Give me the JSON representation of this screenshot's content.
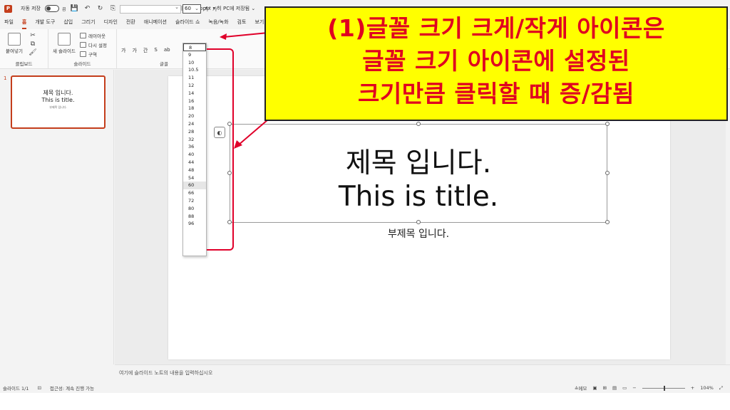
{
  "titlebar": {
    "autosave_label": "자동 저장",
    "autosave_state": "끔",
    "document_title": "New 프레젠테이션 문서.pptx • 이 PC에 저장됨 ⌄"
  },
  "tabs": [
    "파일",
    "홈",
    "개발 도구",
    "삽입",
    "그리기",
    "디자인",
    "전환",
    "애니메이션",
    "슬라이드 쇼",
    "녹음/녹화",
    "검토",
    "보기"
  ],
  "active_tab": "홈",
  "ribbon": {
    "clipboard": {
      "paste_label": "붙여넣기",
      "group_label": "클립보드"
    },
    "slides": {
      "new_slide_label": "새 슬라이드",
      "layout_label": "레이아웃",
      "reset_label": "다시 설정",
      "section_label": "구역",
      "group_label": "슬라이드"
    },
    "font": {
      "size_value": "60",
      "grow_label": "가˄",
      "shrink_label": "가˅",
      "group_label": "글꼴",
      "format_buttons": [
        "가",
        "가",
        "간",
        "S",
        "ab"
      ]
    }
  },
  "font_sizes": [
    "8",
    "9",
    "10",
    "10.5",
    "11",
    "12",
    "14",
    "16",
    "18",
    "20",
    "24",
    "28",
    "32",
    "36",
    "40",
    "44",
    "48",
    "54",
    "60",
    "66",
    "72",
    "80",
    "88",
    "96"
  ],
  "selected_size": "60",
  "slide_panel": {
    "slide_number": "1",
    "thumb_title_line1": "제목 입니다.",
    "thumb_title_line2": "This is title.",
    "thumb_subtitle": "부제목 입니다."
  },
  "slide": {
    "title_line1": "제목 입니다.",
    "title_line2": "This is title.",
    "subtitle": "부제목 입니다."
  },
  "notes_placeholder": "여기에 슬라이드 노트의 내용을 입력하십시오",
  "statusbar": {
    "slide_count": "슬라이드 1/1",
    "accessibility": "접근성: 계속 진행 가능",
    "notes_label": "≙메모",
    "zoom": "104%"
  },
  "callout": {
    "line1": "(1)글꼴 크기 크게/작게 아이콘은",
    "line2": "글꼴 크기 아이콘에 설정된",
    "line3": "크기만큼 클릭할 때 증/감됨"
  },
  "colors": {
    "accent": "#c43e1c",
    "callout_bg": "#ffff00",
    "callout_text": "#e00020",
    "annotation_red": "#e0002a"
  }
}
